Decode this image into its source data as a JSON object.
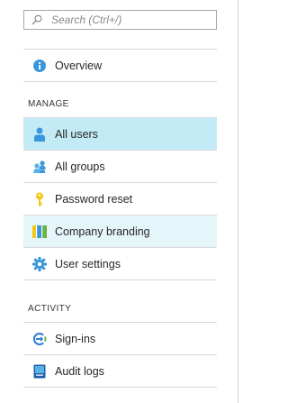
{
  "search": {
    "placeholder": "Search (Ctrl+/)"
  },
  "top_items": [
    {
      "label": "Overview",
      "icon": "info-icon"
    }
  ],
  "sections": [
    {
      "heading": "MANAGE",
      "items": [
        {
          "label": "All users",
          "icon": "user-icon",
          "state": "selected"
        },
        {
          "label": "All groups",
          "icon": "group-icon"
        },
        {
          "label": "Password reset",
          "icon": "key-icon"
        },
        {
          "label": "Company branding",
          "icon": "branding-icon",
          "state": "hover"
        },
        {
          "label": "User settings",
          "icon": "gear-icon"
        }
      ]
    },
    {
      "heading": "ACTIVITY",
      "items": [
        {
          "label": "Sign-ins",
          "icon": "sign-ins-icon"
        },
        {
          "label": "Audit logs",
          "icon": "audit-log-icon"
        }
      ]
    }
  ],
  "colors": {
    "selected_bg": "#c3ebf6",
    "hover_bg": "#e5f6fb",
    "accent_blue": "#3a96dd",
    "key_yellow": "#f5c518"
  }
}
